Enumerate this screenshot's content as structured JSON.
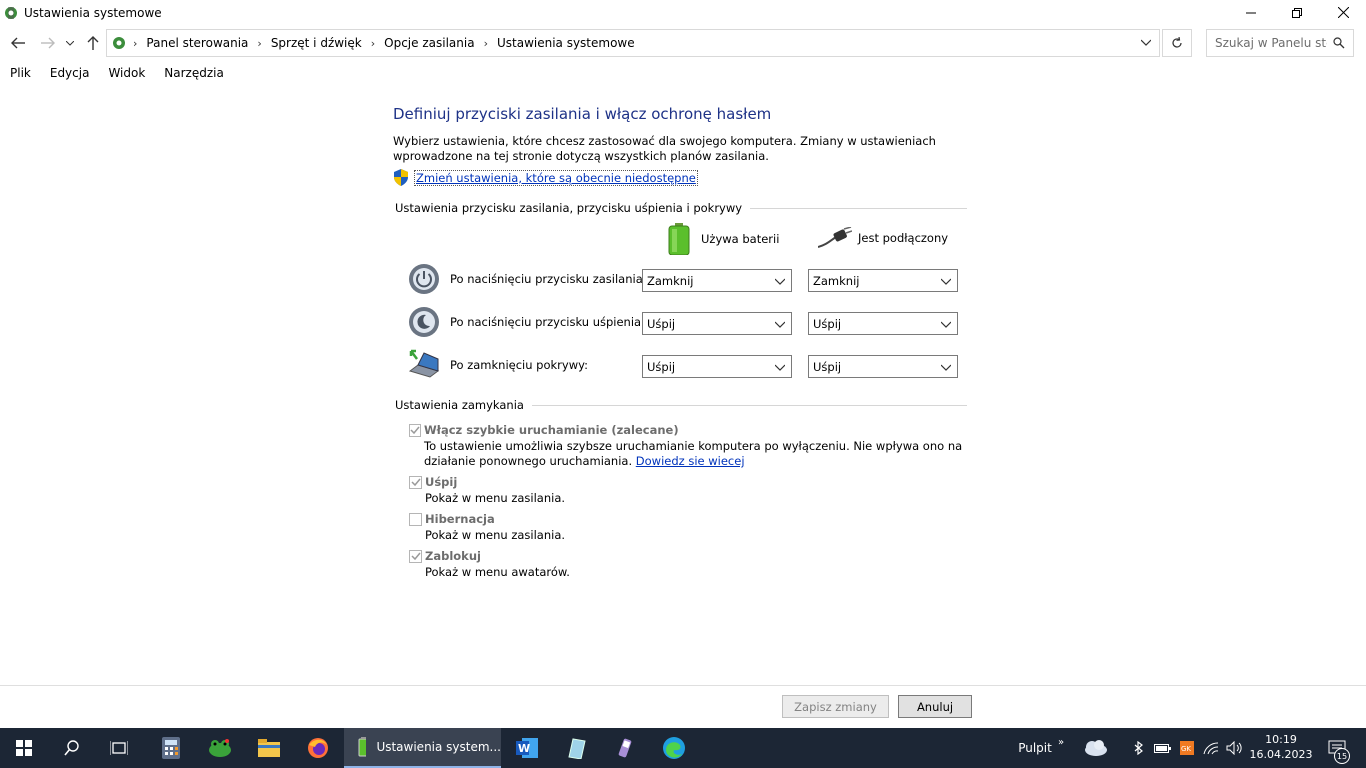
{
  "window": {
    "title": "Ustawienia systemowe"
  },
  "breadcrumb": [
    "Panel sterowania",
    "Sprzęt i dźwięk",
    "Opcje zasilania",
    "Ustawienia systemowe"
  ],
  "search": {
    "placeholder": "Szukaj w Panelu ste..."
  },
  "menu": {
    "file": "Plik",
    "edit": "Edycja",
    "view": "Widok",
    "tools": "Narzędzia"
  },
  "page": {
    "heading": "Definiuj przyciski zasilania i włącz ochronę hasłem",
    "description": "Wybierz ustawienia, które chcesz zastosować dla swojego komputera. Zmiany w ustawieniach wprowadzone na tej stronie dotyczą wszystkich planów zasilania.",
    "change_link": "Zmień ustawienia, które są obecnie niedostępne"
  },
  "power_section": {
    "title": "Ustawienia przycisku zasilania, przycisku uśpienia i pokrywy",
    "col_battery": "Używa baterii",
    "col_plugged": "Jest podłączony",
    "rows": [
      {
        "label": "Po naciśnięciu przycisku zasilania:",
        "battery": "Zamknij",
        "plugged": "Zamknij"
      },
      {
        "label": "Po naciśnięciu przycisku uśpienia:",
        "battery": "Uśpij",
        "plugged": "Uśpij"
      },
      {
        "label": "Po zamknięciu pokrywy:",
        "battery": "Uśpij",
        "plugged": "Uśpij"
      }
    ]
  },
  "shutdown_section": {
    "title": "Ustawienia zamykania",
    "fast_startup": {
      "label": "Włącz szybkie uruchamianie (zalecane)",
      "desc": "To ustawienie umożliwia szybsze uruchamianie komputera po wyłączeniu. Nie wpływa ono na działanie ponownego uruchamiania.",
      "link": "Dowiedz sie wiecej",
      "checked": true
    },
    "sleep": {
      "label": "Uśpij",
      "desc": "Pokaż w menu zasilania.",
      "checked": true
    },
    "hibernate": {
      "label": "Hibernacja",
      "desc": "Pokaż w menu zasilania.",
      "checked": false
    },
    "lock": {
      "label": "Zablokuj",
      "desc": "Pokaż w menu awatarów.",
      "checked": true
    }
  },
  "buttons": {
    "save": "Zapisz zmiany",
    "cancel": "Anuluj"
  },
  "taskbar": {
    "active_app": "Ustawienia system...",
    "desktop_label": "Pulpit",
    "time": "10:19",
    "date": "16.04.2023",
    "notification_count": "15"
  },
  "colors": {
    "heading": "#1e3287",
    "link": "#0033bb",
    "taskbar": "#1c2635"
  }
}
